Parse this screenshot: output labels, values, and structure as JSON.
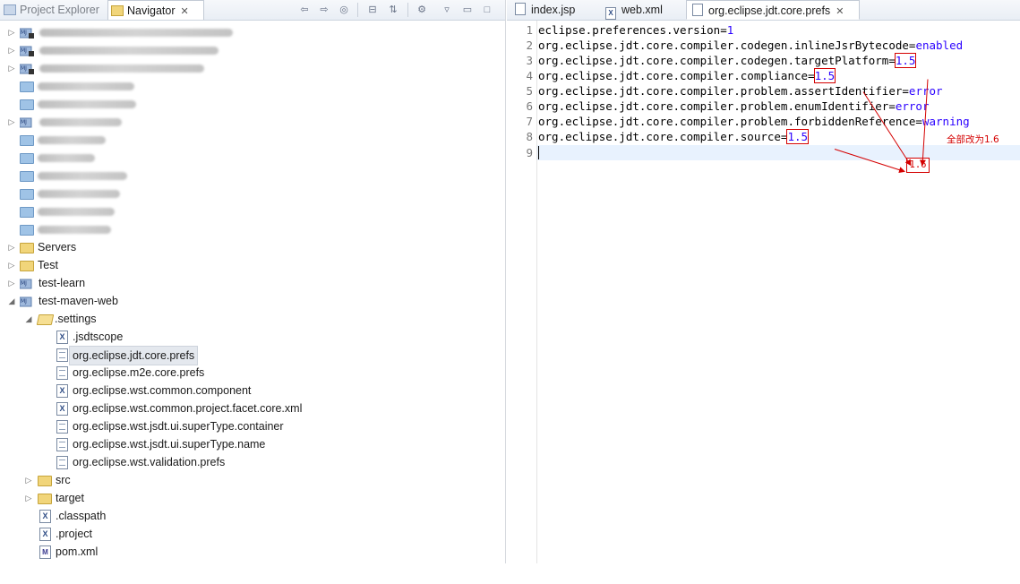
{
  "left_panel": {
    "tabs": {
      "project_explorer": "Project Explorer",
      "navigator": "Navigator"
    },
    "tree": [
      {
        "label": "",
        "blurred": true
      },
      {
        "label": "",
        "blurred": true
      },
      {
        "label": "",
        "blurred": true
      },
      {
        "label": "",
        "blurred": true
      },
      {
        "label": "",
        "blurred": true
      },
      {
        "label": "",
        "blurred": true
      },
      {
        "label": "",
        "blurred": true
      },
      {
        "label": "",
        "blurred": true
      },
      {
        "label": "",
        "blurred": true
      },
      {
        "label": "",
        "blurred": true
      },
      {
        "label": "",
        "blurred": true
      },
      {
        "label": "",
        "blurred": true
      },
      {
        "label": "Servers"
      },
      {
        "label": "Test"
      },
      {
        "label": "test-learn"
      },
      {
        "label": "test-maven-web"
      },
      {
        "label": ".settings"
      },
      {
        "label": ".jsdtscope"
      },
      {
        "label": "org.eclipse.jdt.core.prefs",
        "selected": true
      },
      {
        "label": "org.eclipse.m2e.core.prefs"
      },
      {
        "label": "org.eclipse.wst.common.component"
      },
      {
        "label": "org.eclipse.wst.common.project.facet.core.xml"
      },
      {
        "label": "org.eclipse.wst.jsdt.ui.superType.container"
      },
      {
        "label": "org.eclipse.wst.jsdt.ui.superType.name"
      },
      {
        "label": "org.eclipse.wst.validation.prefs"
      },
      {
        "label": "src"
      },
      {
        "label": "target"
      },
      {
        "label": ".classpath"
      },
      {
        "label": ".project"
      },
      {
        "label": "pom.xml"
      }
    ]
  },
  "editor": {
    "tabs": [
      "index.jsp",
      "web.xml",
      "org.eclipse.jdt.core.prefs"
    ],
    "active_tab": "org.eclipse.jdt.core.prefs",
    "lines": [
      {
        "num": "1",
        "key": "eclipse.preferences.version=",
        "value": "1"
      },
      {
        "num": "2",
        "key": "org.eclipse.jdt.core.compiler.codegen.inlineJsrBytecode=",
        "value": "enabled"
      },
      {
        "num": "3",
        "key": "org.eclipse.jdt.core.compiler.codegen.targetPlatform=",
        "value": "1.5"
      },
      {
        "num": "4",
        "key": "org.eclipse.jdt.core.compiler.compliance=",
        "value": "1.5"
      },
      {
        "num": "5",
        "key": "org.eclipse.jdt.core.compiler.problem.assertIdentifier=",
        "value": "error"
      },
      {
        "num": "6",
        "key": "org.eclipse.jdt.core.compiler.problem.enumIdentifier=",
        "value": "error"
      },
      {
        "num": "7",
        "key": "org.eclipse.jdt.core.compiler.problem.forbiddenReference=",
        "value": "warning"
      },
      {
        "num": "8",
        "key": "org.eclipse.jdt.core.compiler.source=",
        "value": "1.5"
      },
      {
        "num": "9",
        "key": "",
        "value": ""
      }
    ],
    "annotation": {
      "note": "全部改为1.6",
      "target_value": "1.6",
      "color": "#d40000"
    }
  }
}
